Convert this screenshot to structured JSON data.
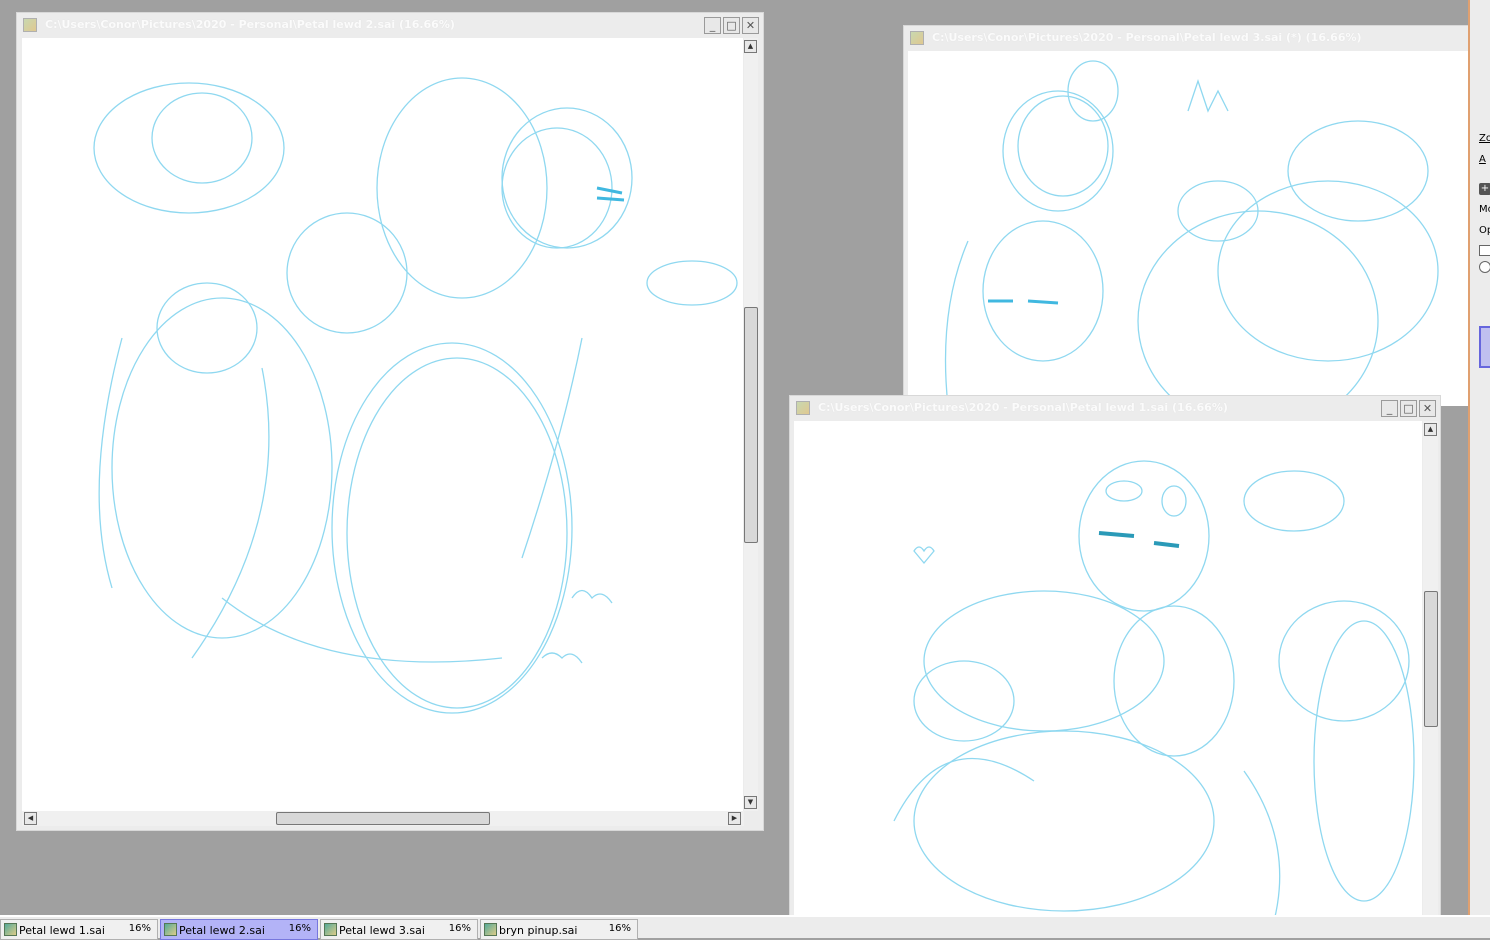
{
  "windows": [
    {
      "title": "C:\\Users\\Conor\\Pictures\\2020 - Personal\\Petal lewd 2.sai (16.66%)"
    },
    {
      "title": "C:\\Users\\Conor\\Pictures\\2020 - Personal\\Petal lewd 3.sai (*) (16.66%)"
    },
    {
      "title": "C:\\Users\\Conor\\Pictures\\2020 - Personal\\Petal lewd 1.sai (16.66%)"
    }
  ],
  "window_buttons": {
    "minimize": "_",
    "maximize": "□",
    "close": "✕"
  },
  "taskbar": [
    {
      "name": "Petal lewd 1.sai",
      "zoom": "16%",
      "active": false
    },
    {
      "name": "Petal lewd 2.sai",
      "zoom": "16%",
      "active": true
    },
    {
      "name": "Petal lewd 3.sai",
      "zoom": "16%",
      "active": false
    },
    {
      "name": "bryn pinup.sai",
      "zoom": "16%",
      "active": false
    }
  ],
  "right_panel": {
    "zoom_label": "Zo",
    "angle_label": "A",
    "mode_label": "Mo",
    "opacity_label": "Op"
  },
  "colors": {
    "sketch": "#8fd8f0",
    "active_tab": "#b3b3f7",
    "background": "#a0a0a0"
  }
}
